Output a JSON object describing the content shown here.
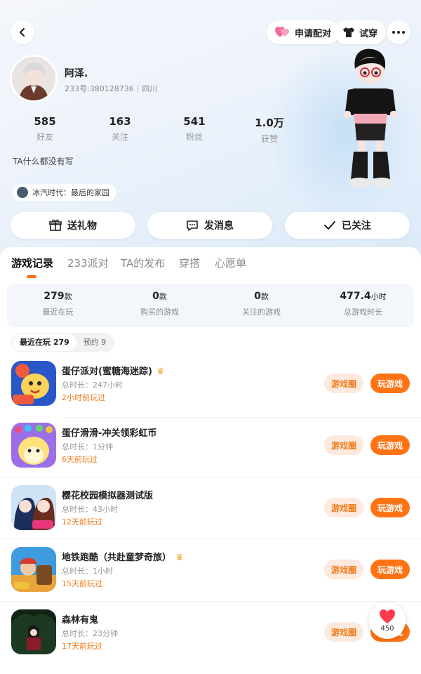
{
  "header": {
    "pair_label": "申请配对",
    "tryon_label": "试穿"
  },
  "profile": {
    "nickname": "阿泽.",
    "uid": "233号:380128736",
    "region": "四川",
    "bio": "TA什么都没有写",
    "game_tag": "冰汽时代：最后的家园",
    "stats": [
      {
        "value": "585",
        "label": "好友"
      },
      {
        "value": "163",
        "label": "关注"
      },
      {
        "value": "541",
        "label": "粉丝"
      },
      {
        "value": "1.0万",
        "label": "获赞"
      }
    ]
  },
  "actions": {
    "gift": "送礼物",
    "message": "发消息",
    "follow": "已关注"
  },
  "tabs": [
    "游戏记录",
    "233派对",
    "TA的发布",
    "穿搭",
    "心愿单"
  ],
  "summary": [
    {
      "value": "279",
      "unit": "款",
      "label": "最近在玩"
    },
    {
      "value": "0",
      "unit": "款",
      "label": "购买的游戏"
    },
    {
      "value": "0",
      "unit": "款",
      "label": "关注的游戏"
    },
    {
      "value": "477.4",
      "unit": "小时",
      "label": "总游戏时长"
    }
  ],
  "segment": {
    "recent": "最近在玩 279",
    "reserve": "预约 9"
  },
  "games": [
    {
      "name": "蛋仔派对(蜜糖海迷踪)",
      "duration": "总时长：247小时",
      "last": "2小时前玩过",
      "circle": "游戏圈",
      "play": "玩游戏"
    },
    {
      "name": "蛋仔滑滑-冲关领彩虹币",
      "duration": "总时长：1分钟",
      "last": "6天前玩过",
      "circle": "游戏圈",
      "play": "玩游戏"
    },
    {
      "name": "樱花校园模拟器测试版",
      "duration": "总时长：43小时",
      "last": "12天前玩过",
      "circle": "游戏圈",
      "play": "玩游戏"
    },
    {
      "name": "地铁跑酷（共赴童梦奇旅）",
      "duration": "总时长：1小时",
      "last": "15天前玩过",
      "circle": "游戏圈",
      "play": "玩游戏"
    },
    {
      "name": "森林有鬼",
      "duration": "总时长：23分钟",
      "last": "17天前玩过",
      "circle": "游戏圈",
      "play": "玩游戏"
    }
  ],
  "like_count": "450",
  "colors": {
    "accent": "#ff7314",
    "accent_light": "#fde9dd",
    "last_played": "#f07a1a"
  }
}
